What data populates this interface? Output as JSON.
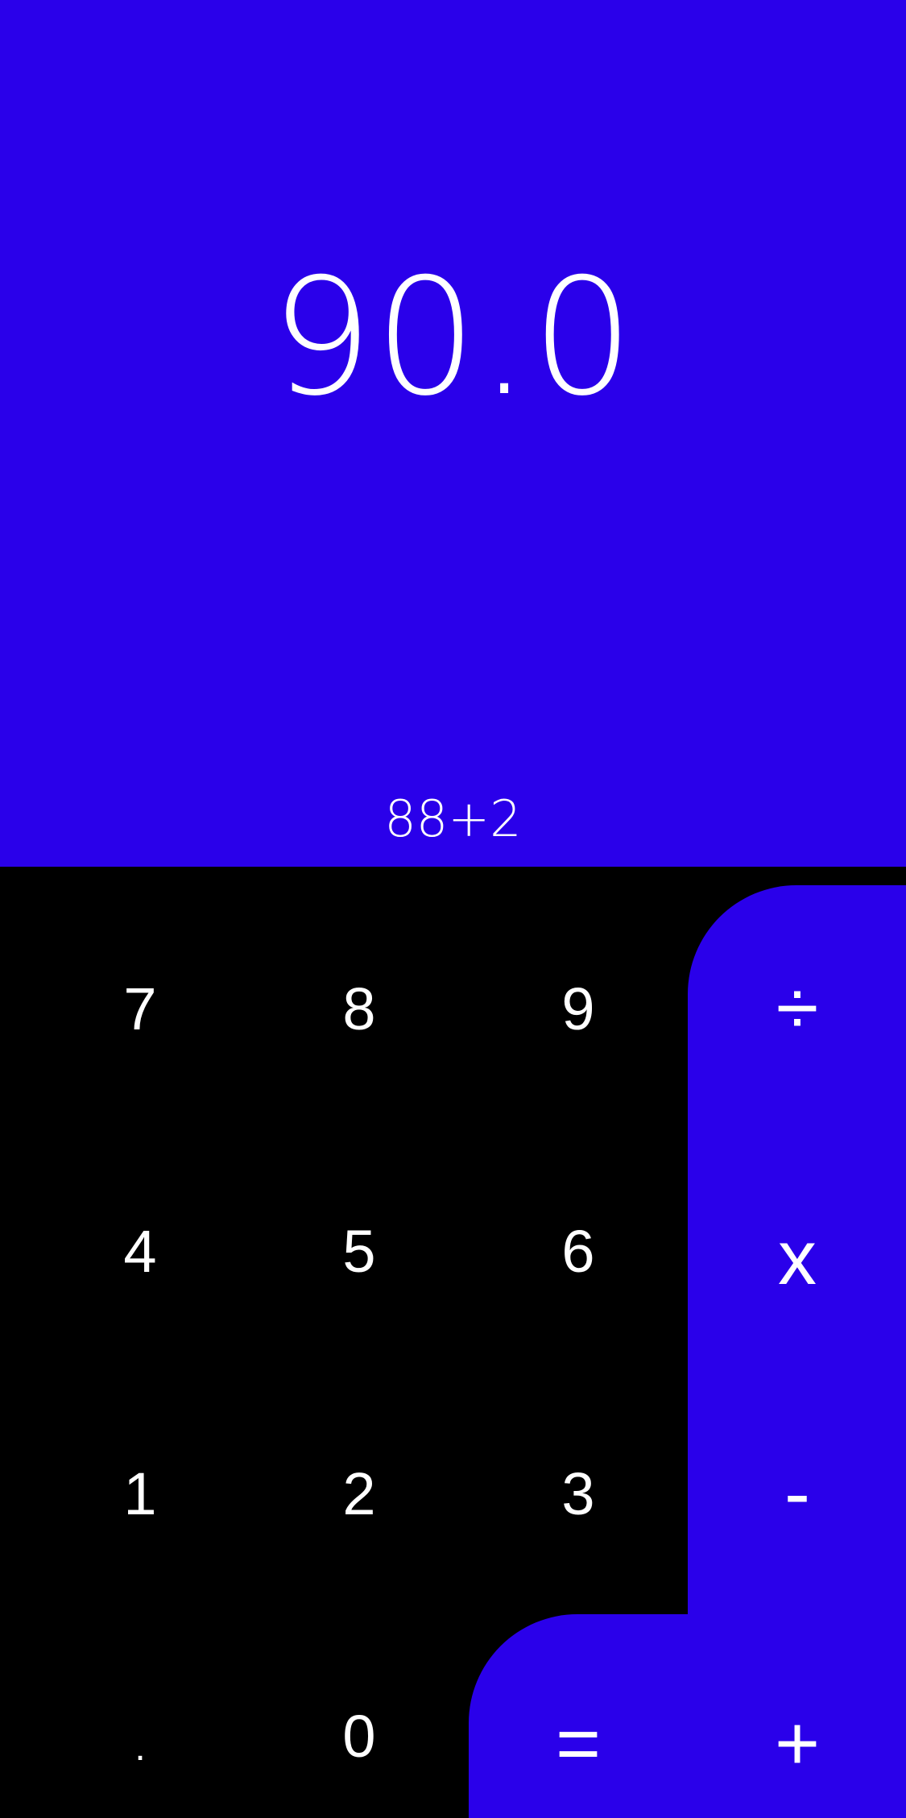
{
  "display": {
    "result": "90.0",
    "expression": "88+2"
  },
  "keypad": {
    "row1": [
      "7",
      "8",
      "9"
    ],
    "row2": [
      "4",
      "5",
      "6"
    ],
    "row3": [
      "1",
      "2",
      "3"
    ],
    "row4": [
      ".",
      "0"
    ],
    "operators": {
      "divide": "÷",
      "multiply": "x",
      "subtract": "-",
      "add": "+",
      "equals": "="
    }
  },
  "colors": {
    "accent": "#2a00ea",
    "background": "#000000",
    "text": "#ffffff"
  }
}
